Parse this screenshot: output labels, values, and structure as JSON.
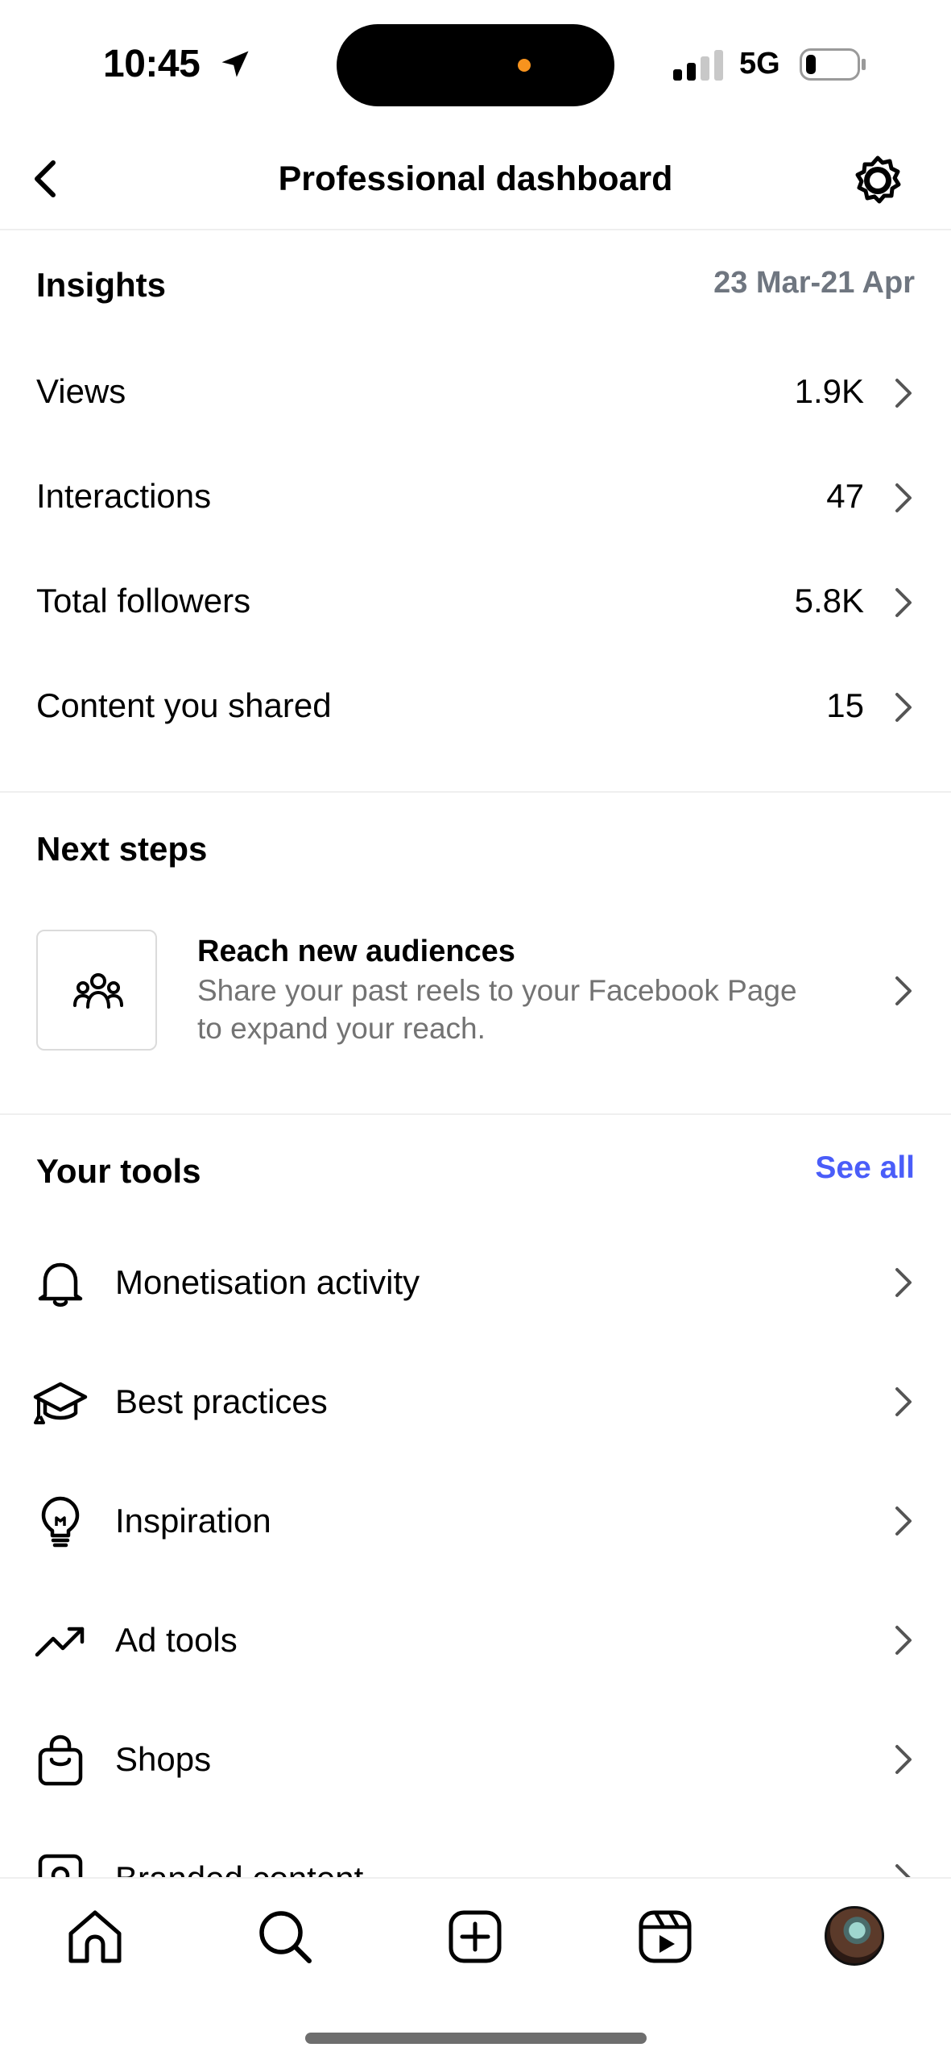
{
  "status_bar": {
    "time": "10:45",
    "network": "5G",
    "icons": [
      "location-arrow-icon",
      "signal-icon",
      "battery-icon"
    ]
  },
  "header": {
    "title": "Professional dashboard",
    "back_icon": "chevron-left-icon",
    "settings_icon": "settings-gear-icon"
  },
  "insights": {
    "title": "Insights",
    "date_range": "23 Mar-21 Apr",
    "rows": [
      {
        "label": "Views",
        "value": "1.9K"
      },
      {
        "label": "Interactions",
        "value": "47"
      },
      {
        "label": "Total followers",
        "value": "5.8K"
      },
      {
        "label": "Content you shared",
        "value": "15"
      }
    ]
  },
  "next_steps": {
    "title": "Next steps",
    "card": {
      "icon": "people-group-icon",
      "title": "Reach new audiences",
      "description": "Share your past reels to your Facebook Page to expand your reach."
    }
  },
  "tools": {
    "title": "Your tools",
    "see_all": "See all",
    "accent_color": "#4a5df9",
    "items": [
      {
        "label": "Monetisation activity",
        "icon": "bell-icon"
      },
      {
        "label": "Best practices",
        "icon": "graduation-cap-icon"
      },
      {
        "label": "Inspiration",
        "icon": "lightbulb-icon"
      },
      {
        "label": "Ad tools",
        "icon": "trending-up-icon"
      },
      {
        "label": "Shops",
        "icon": "shopping-bag-icon"
      },
      {
        "label": "Branded content",
        "icon": "branded-content-icon"
      }
    ]
  },
  "tab_bar": {
    "items": [
      "home-icon",
      "search-icon",
      "create-plus-icon",
      "reels-icon",
      "profile-avatar"
    ]
  }
}
